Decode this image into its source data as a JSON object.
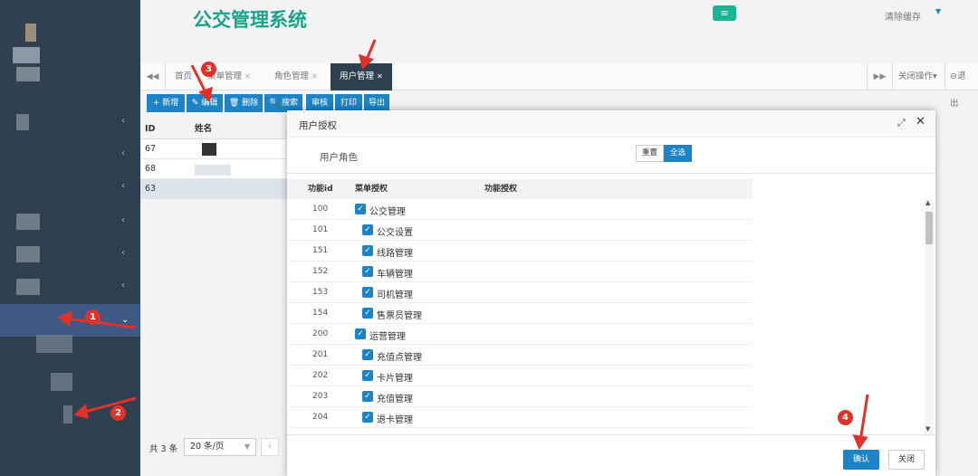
{
  "app": {
    "title": "公交管理系统",
    "menu_toggle_icon": "≡",
    "clear_cache": "清除缓存",
    "clear_cache_caret": "▼"
  },
  "sidebar": {
    "chevron": "‹",
    "active_chevron": "⌄"
  },
  "tabs": {
    "prev_icon": "◀◀",
    "next_icon": "▶▶",
    "items": [
      {
        "label": "首页"
      },
      {
        "label": "菜单管理"
      },
      {
        "label": "角色管理"
      },
      {
        "label": "用户管理"
      }
    ],
    "close_glyph": "✕",
    "close_ops": "关闭操作▾",
    "logout": "⊖退出"
  },
  "toolbar": {
    "add": "+ 新增",
    "edit": "✎ 编辑",
    "delete": "🗑 删除",
    "search": "🔍 搜索",
    "audit": "审核",
    "print": "打印",
    "export": "导出"
  },
  "grid": {
    "headers": {
      "id": "ID",
      "name": "姓名"
    },
    "rows": [
      {
        "id": "67"
      },
      {
        "id": "68"
      },
      {
        "id": "63"
      }
    ],
    "total": "共 3 条",
    "page_size": "20 条/页",
    "page_size_caret": "▼",
    "prev_page": "‹"
  },
  "modal": {
    "title": "用户授权",
    "maximize_icon": "⤢",
    "close_icon": "✕",
    "role_label": "用户角色",
    "reset": "重置",
    "select_all": "全选",
    "headers": {
      "id": "功能id",
      "menu": "菜单授权",
      "function": "功能授权"
    },
    "check_glyph": "✓",
    "rows": [
      {
        "id": "100",
        "label": "公交管理",
        "level": 0
      },
      {
        "id": "101",
        "label": "公交设置",
        "level": 1
      },
      {
        "id": "151",
        "label": "线路管理",
        "level": 1
      },
      {
        "id": "152",
        "label": "车辆管理",
        "level": 1
      },
      {
        "id": "153",
        "label": "司机管理",
        "level": 1
      },
      {
        "id": "154",
        "label": "售票员管理",
        "level": 1
      },
      {
        "id": "200",
        "label": "运营管理",
        "level": 0
      },
      {
        "id": "201",
        "label": "充值点管理",
        "level": 1
      },
      {
        "id": "202",
        "label": "卡片管理",
        "level": 1
      },
      {
        "id": "203",
        "label": "充值管理",
        "level": 1
      },
      {
        "id": "204",
        "label": "退卡管理",
        "level": 1
      }
    ],
    "scroll_up": "▲",
    "scroll_down": "▼",
    "confirm": "确认",
    "close": "关闭"
  },
  "annotations": {
    "badges": [
      "1",
      "2",
      "3",
      "4"
    ],
    "color": "#e0312b"
  },
  "colors": {
    "sidebar": "#2f4050",
    "brand_green": "#1aa28a",
    "primary_blue": "#1c84c6",
    "active_nav": "#3e5a84"
  }
}
